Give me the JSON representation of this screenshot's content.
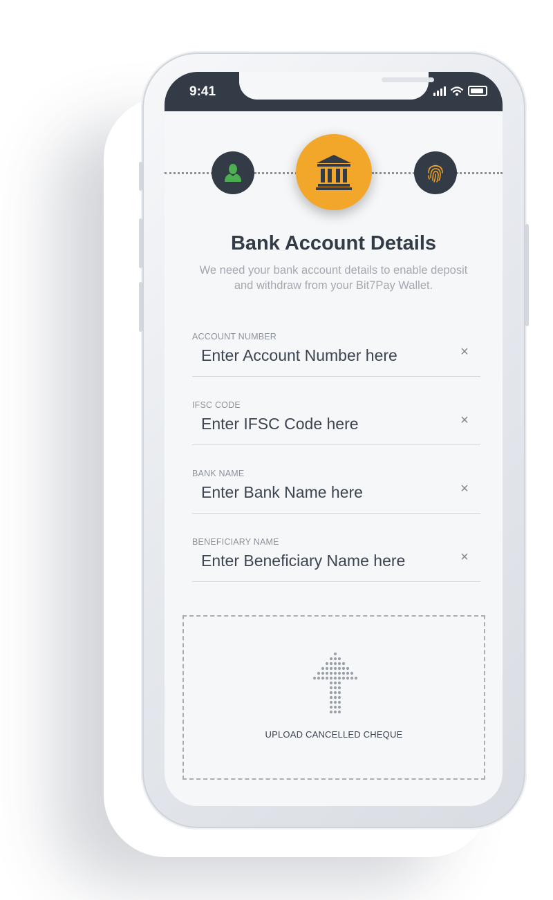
{
  "status_bar": {
    "time": "9:41"
  },
  "stepper": {
    "steps": [
      {
        "icon": "user-icon",
        "state": "completed"
      },
      {
        "icon": "bank-icon",
        "state": "active"
      },
      {
        "icon": "fingerprint-icon",
        "state": "pending"
      }
    ]
  },
  "page": {
    "title": "Bank Account Details",
    "subtitle": "We need your bank account details to enable deposit and withdraw from  your Bit7Pay Wallet."
  },
  "form": {
    "fields": [
      {
        "label": "ACCOUNT NUMBER",
        "placeholder": "Enter Account Number here",
        "value": ""
      },
      {
        "label": "IFSC CODE",
        "placeholder": "Enter IFSC Code here",
        "value": ""
      },
      {
        "label": "BANK NAME",
        "placeholder": "Enter Bank Name here",
        "value": ""
      },
      {
        "label": "BENEFICIARY NAME",
        "placeholder": "Enter Beneficiary Name here",
        "value": ""
      }
    ],
    "clear_symbol": "×"
  },
  "upload": {
    "label": "UPLOAD CANCELLED CHEQUE",
    "icon": "upload-arrow-icon"
  },
  "colors": {
    "accent": "#f2a72b",
    "dark": "#333b47",
    "success": "#4caf50",
    "muted": "#a3a8b0"
  }
}
